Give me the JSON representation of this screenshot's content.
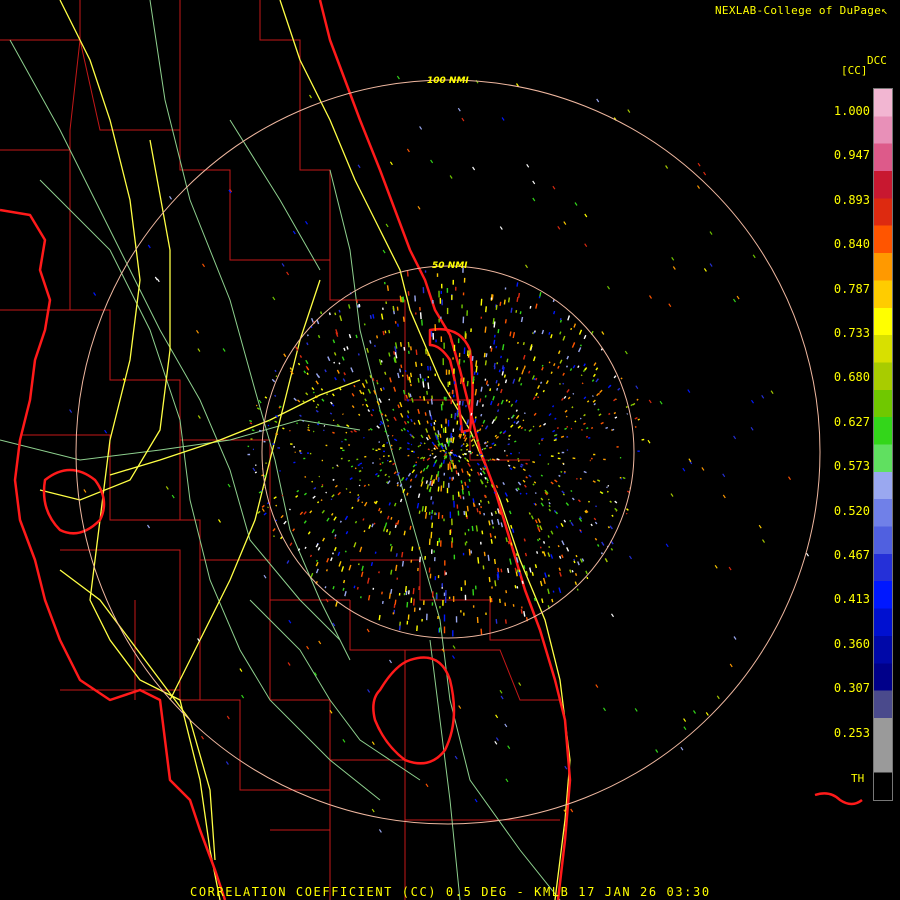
{
  "credit": "NEXLAB-College of DuPage",
  "logo_glyph": "↖",
  "product": {
    "code_label": "DCC",
    "unit_label": "[CC]",
    "threshold_label": "TH",
    "footer_text": "CORRELATION COEFFICIENT (CC) 0.5 DEG - KMLB 17 JAN 26 03:30"
  },
  "range_rings": [
    {
      "label": "100 NMI",
      "radius_nmi": 100
    },
    {
      "label": "50 NMI",
      "radius_nmi": 50
    }
  ],
  "legend": {
    "labels": [
      "1.000",
      "0.947",
      "0.893",
      "0.840",
      "0.787",
      "0.733",
      "0.680",
      "0.627",
      "0.573",
      "0.520",
      "0.467",
      "0.413",
      "0.360",
      "0.307",
      "0.253"
    ],
    "colors_top_to_bottom": [
      "#f2b6d2",
      "#e890b8",
      "#dd5a8a",
      "#c81830",
      "#dd2a10",
      "#ff5500",
      "#ff9900",
      "#ffcc00",
      "#ffff00",
      "#d8e000",
      "#a8cc00",
      "#70c800",
      "#33d61a",
      "#60e060",
      "#9aa8f0",
      "#7080e8",
      "#5060e0",
      "#2530d8",
      "#0018ff",
      "#0010d0",
      "#0008a8",
      "#00008a",
      "#4a4a8c",
      "#9a9a9a",
      "#9a9a9a",
      "#000000"
    ],
    "colors": {
      "map_boundary": "#d62020",
      "coastline": "#ff1a1a",
      "highway": "#ffff44",
      "road": "#8ed08e",
      "range_ring": "#f0b8a0",
      "text": "#ffff00"
    }
  }
}
